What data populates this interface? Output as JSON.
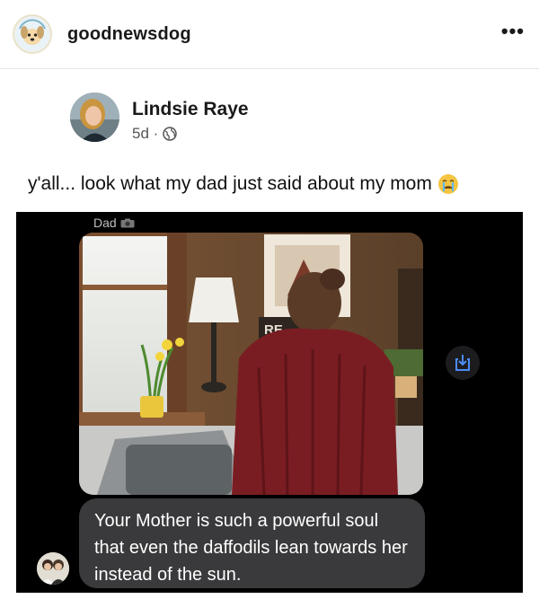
{
  "header": {
    "username": "goodnewsdog",
    "more_label": "•••",
    "avatar_icon": "goodnewsdog-logo-icon"
  },
  "post": {
    "author": "Lindsie Raye",
    "time": "5d ·",
    "privacy_icon": "globe-icon",
    "caption": "y'all... look what my dad just said about my mom",
    "caption_emoji": "crying-face-emoji"
  },
  "message": {
    "sender_label": "Dad",
    "sender_badge_icon": "camera-icon",
    "photo_sign_text": "RE",
    "bubble_text": "Your Mother is such a powerful soul that even the daffodils lean towards her instead of the sun.",
    "share_icon": "share-download-icon"
  },
  "colors": {
    "chat_background": "#000000",
    "bubble": "#3a3a3c",
    "share_accent": "#4a8cf7"
  }
}
